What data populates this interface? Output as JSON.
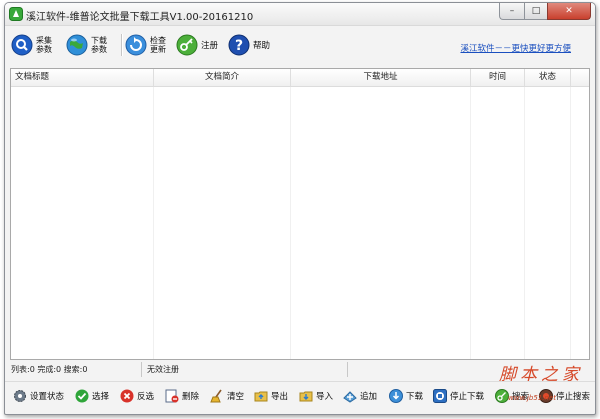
{
  "window": {
    "title": "溪江软件-维普论文批量下载工具V1.00-20161210",
    "controls": {
      "minimize": "–",
      "maximize": "□",
      "close": "✕"
    }
  },
  "toolbar": {
    "buttons": [
      {
        "label": "采集参数",
        "icon": "search-icon"
      },
      {
        "label": "下载参数",
        "icon": "globe-icon"
      },
      {
        "label": "检查更新",
        "icon": "refresh-icon"
      },
      {
        "label": "注册",
        "icon": "key-icon"
      },
      {
        "label": "帮助",
        "icon": "help-icon"
      }
    ],
    "promo_link": "溪江软件－－更快更好更方便"
  },
  "grid": {
    "columns": [
      "文档标题",
      "文档简介",
      "下载地址",
      "时间",
      "状态"
    ],
    "rows": []
  },
  "status": {
    "counts": "列表:0 完成:0 搜索:0",
    "registration": "无效注册",
    "watermark": "脚本之家",
    "watermark_url": "www.jb51.net"
  },
  "bottom_bar": {
    "buttons": [
      {
        "label": "设置状态",
        "icon": "gear-icon"
      },
      {
        "label": "选择",
        "icon": "check-icon"
      },
      {
        "label": "反选",
        "icon": "x-icon"
      },
      {
        "label": "删除",
        "icon": "delete-icon"
      },
      {
        "label": "清空",
        "icon": "broom-icon"
      },
      {
        "label": "导出",
        "icon": "export-folder-icon"
      },
      {
        "label": "导入",
        "icon": "import-folder-icon"
      },
      {
        "label": "追加",
        "icon": "add-icon"
      },
      {
        "label": "下载",
        "icon": "download-icon"
      },
      {
        "label": "停止下载",
        "icon": "stop-download-icon"
      },
      {
        "label": "搜索",
        "icon": "search-key-icon"
      },
      {
        "label": "停止搜索",
        "icon": "stop-search-icon"
      }
    ]
  },
  "colors": {
    "accent": "#1f5fc6",
    "link": "#1a4fbf",
    "window_bg": "#f3f3f3"
  }
}
